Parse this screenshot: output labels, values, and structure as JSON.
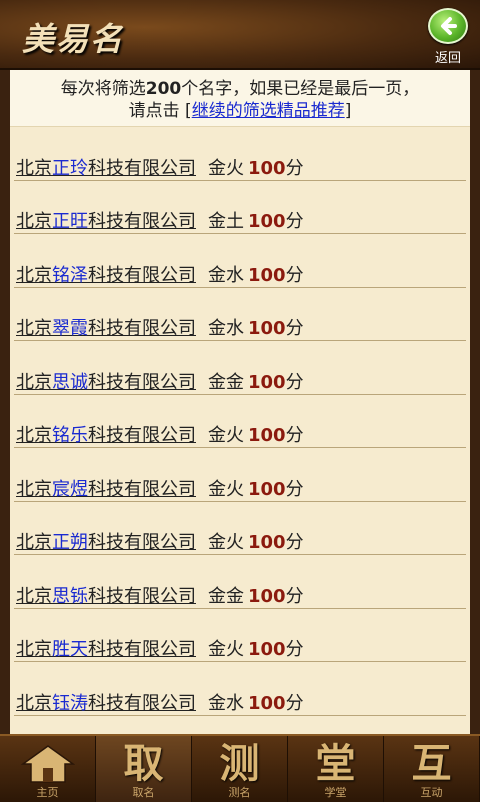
{
  "header": {
    "logo_text": "美易名",
    "back_label": "返回"
  },
  "notice": {
    "line1_prefix": "每次将筛选",
    "line1_count": "200",
    "line1_suffix": "个名字，如果已经是最后一页，",
    "line2_prefix": "请点击 [",
    "link_text": "继续的筛选精品推荐",
    "line2_suffix": "]"
  },
  "list": [
    {
      "prefix": "北京",
      "name": "正玲",
      "suffix": "科技有限公司",
      "element": "金火",
      "score": "100",
      "unit": "分"
    },
    {
      "prefix": "北京",
      "name": "正旺",
      "suffix": "科技有限公司",
      "element": "金土",
      "score": "100",
      "unit": "分"
    },
    {
      "prefix": "北京",
      "name": "铭泽",
      "suffix": "科技有限公司",
      "element": "金水",
      "score": "100",
      "unit": "分"
    },
    {
      "prefix": "北京",
      "name": "翠霞",
      "suffix": "科技有限公司",
      "element": "金水",
      "score": "100",
      "unit": "分"
    },
    {
      "prefix": "北京",
      "name": "思诚",
      "suffix": "科技有限公司",
      "element": "金金",
      "score": "100",
      "unit": "分"
    },
    {
      "prefix": "北京",
      "name": "铭乐",
      "suffix": "科技有限公司",
      "element": "金火",
      "score": "100",
      "unit": "分"
    },
    {
      "prefix": "北京",
      "name": "宸煜",
      "suffix": "科技有限公司",
      "element": "金火",
      "score": "100",
      "unit": "分"
    },
    {
      "prefix": "北京",
      "name": "正朔",
      "suffix": "科技有限公司",
      "element": "金火",
      "score": "100",
      "unit": "分"
    },
    {
      "prefix": "北京",
      "name": "思铄",
      "suffix": "科技有限公司",
      "element": "金金",
      "score": "100",
      "unit": "分"
    },
    {
      "prefix": "北京",
      "name": "胜天",
      "suffix": "科技有限公司",
      "element": "金火",
      "score": "100",
      "unit": "分"
    },
    {
      "prefix": "北京",
      "name": "钰涛",
      "suffix": "科技有限公司",
      "element": "金水",
      "score": "100",
      "unit": "分"
    }
  ],
  "nav": [
    {
      "glyph": "",
      "label": "主页",
      "icon": "home-icon"
    },
    {
      "glyph": "取",
      "label": "取名"
    },
    {
      "glyph": "测",
      "label": "测名"
    },
    {
      "glyph": "堂",
      "label": "学堂"
    },
    {
      "glyph": "互",
      "label": "互动"
    }
  ]
}
